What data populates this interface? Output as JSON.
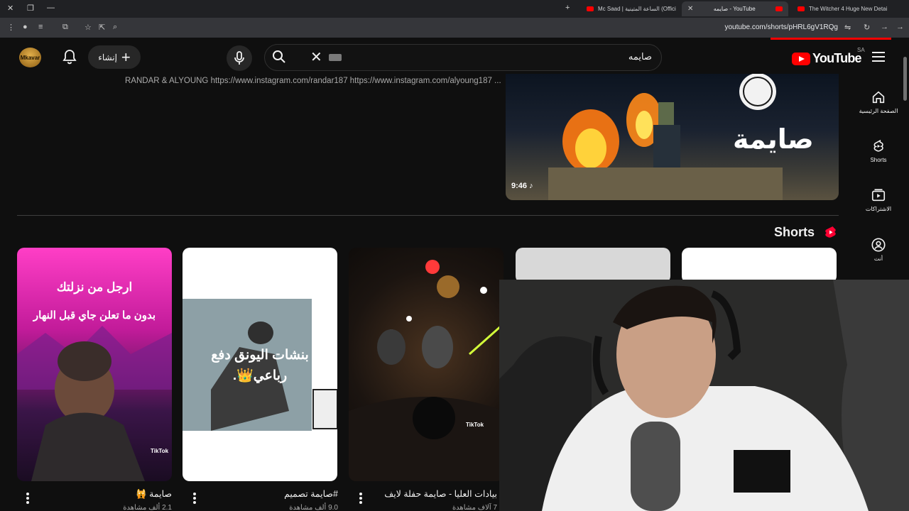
{
  "browser": {
    "tabs": [
      {
        "title": "The Witcher 4 Huge New Detai"
      },
      {
        "title": "صايمه - YouTube",
        "active": true
      },
      {
        "title": "Mc Saad | الساعة المتينية (Offici"
      }
    ],
    "url": "youtube.com/shorts/pHRL6gV1RQg"
  },
  "header": {
    "logo_word": "YouTube",
    "region": "SA",
    "search_query": "صايمه",
    "create_label": "إنشاء",
    "channel_avatar_text": "Mkavar"
  },
  "guide": {
    "items": [
      {
        "label": "الصفحة الرئيسية",
        "icon": "home-icon"
      },
      {
        "label": "Shorts",
        "icon": "shorts-icon"
      },
      {
        "label": "الاشتراكات",
        "icon": "subscriptions-icon"
      },
      {
        "label": "أنت",
        "icon": "you-icon"
      }
    ]
  },
  "video": {
    "description": "RANDAR & ALYOUNG https://www.instagram.com/randar187 https://www.instagram.com/alyoung187 ...",
    "duration": "9:46",
    "thumb_title": "صايمة"
  },
  "shorts": {
    "title": "Shorts",
    "cards": [
      {
        "title": "صايمة 🙀",
        "views": "2.1 ألف مشاهدة",
        "overlay_line1": "ارجل من نزلتك",
        "overlay_line2": "بدون ما تعلن جاي قبل النهار",
        "tiktok": "TikTok"
      },
      {
        "title": "#صايمة تصميم",
        "views": "9.0 ألف مشاهدة",
        "overlay_line1": "بنشات اليونق دفع",
        "overlay_line2": "رباعي👑.",
        "tiktok": ""
      },
      {
        "title": "بيادات العليا - صايمة حفلة لايف",
        "views": "7 آلاف مشاهدة",
        "overlay_line1": "",
        "overlay_line2": "",
        "tiktok": "TikTok"
      },
      {
        "title": "",
        "views": "",
        "overlay_line1": "",
        "overlay_line2": "",
        "tiktok": ""
      },
      {
        "title": "",
        "views": "",
        "overlay_line1": "",
        "overlay_line2": "",
        "tiktok": ""
      }
    ]
  },
  "colors": {
    "background": "#0f0f0f",
    "brand_red": "#ff0000",
    "text": "#f1f1f1",
    "muted": "#aaaaaa"
  }
}
